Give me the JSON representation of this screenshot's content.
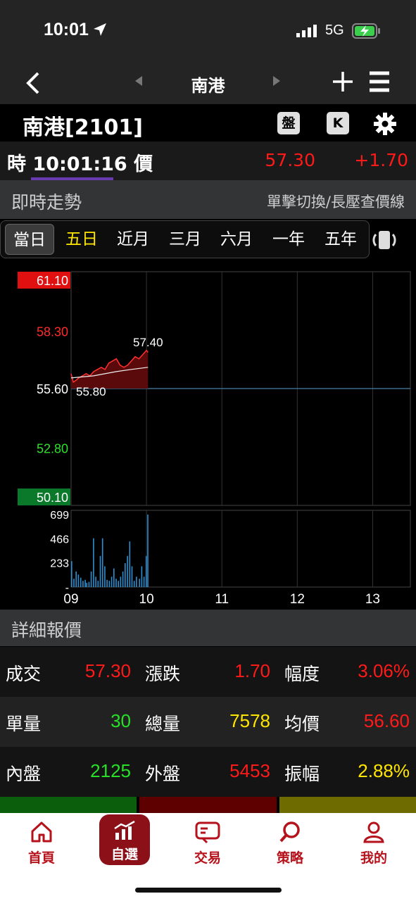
{
  "status_bar": {
    "time": "10:01",
    "network": "5G"
  },
  "nav": {
    "title": "南港"
  },
  "stock": {
    "name": "南港[2101]",
    "btn_pan": "盤",
    "btn_k": "K"
  },
  "quote": {
    "label_time": "時",
    "time": "10:01:16",
    "label_price": "價",
    "price": "57.30",
    "change": "+1.70"
  },
  "section": {
    "title": "即時走勢",
    "hint": "單擊切換/長壓查價線"
  },
  "tabs": [
    {
      "label": "當日",
      "selected": true
    },
    {
      "label": "五日",
      "highlight": true
    },
    {
      "label": "近月"
    },
    {
      "label": "三月"
    },
    {
      "label": "六月"
    },
    {
      "label": "一年"
    },
    {
      "label": "五年"
    }
  ],
  "chart_data": {
    "type": "line",
    "price_axis": {
      "ticks": [
        "61.10",
        "58.30",
        "55.60",
        "52.80",
        "50.10"
      ],
      "min": 50.1,
      "max": 61.1,
      "reference": 55.6
    },
    "annotations": {
      "high": "57.40",
      "low": "55.80"
    },
    "x_ticks": [
      "09",
      "10",
      "11",
      "12",
      "13"
    ],
    "volume_axis": {
      "ticks": [
        "699",
        "466",
        "233",
        "-"
      ],
      "max": 699
    },
    "price_series": [
      [
        9.0,
        56.3
      ],
      [
        9.03,
        55.9
      ],
      [
        9.07,
        56.0
      ],
      [
        9.1,
        56.1
      ],
      [
        9.15,
        56.2
      ],
      [
        9.2,
        56.3
      ],
      [
        9.25,
        56.2
      ],
      [
        9.3,
        56.4
      ],
      [
        9.35,
        56.5
      ],
      [
        9.4,
        56.6
      ],
      [
        9.45,
        56.5
      ],
      [
        9.5,
        56.8
      ],
      [
        9.55,
        56.9
      ],
      [
        9.6,
        57.0
      ],
      [
        9.65,
        56.7
      ],
      [
        9.7,
        56.6
      ],
      [
        9.75,
        56.7
      ],
      [
        9.8,
        56.9
      ],
      [
        9.85,
        57.1
      ],
      [
        9.9,
        57.0
      ],
      [
        9.95,
        57.2
      ],
      [
        10.0,
        57.4
      ],
      [
        10.02,
        57.3
      ]
    ],
    "avg_series": [
      [
        9.0,
        56.1
      ],
      [
        9.3,
        56.2
      ],
      [
        9.6,
        56.4
      ],
      [
        9.8,
        56.5
      ],
      [
        10.02,
        56.6
      ]
    ],
    "volume_series": [
      [
        9.0,
        250
      ],
      [
        9.03,
        80
      ],
      [
        9.06,
        150
      ],
      [
        9.09,
        120
      ],
      [
        9.12,
        90
      ],
      [
        9.15,
        60
      ],
      [
        9.18,
        70
      ],
      [
        9.2,
        40
      ],
      [
        9.23,
        50
      ],
      [
        9.26,
        150
      ],
      [
        9.29,
        470
      ],
      [
        9.32,
        100
      ],
      [
        9.35,
        60
      ],
      [
        9.38,
        300
      ],
      [
        9.41,
        470
      ],
      [
        9.44,
        200
      ],
      [
        9.47,
        70
      ],
      [
        9.5,
        60
      ],
      [
        9.53,
        100
      ],
      [
        9.56,
        180
      ],
      [
        9.59,
        80
      ],
      [
        9.62,
        60
      ],
      [
        9.65,
        100
      ],
      [
        9.68,
        150
      ],
      [
        9.71,
        230
      ],
      [
        9.74,
        300
      ],
      [
        9.77,
        440
      ],
      [
        9.8,
        200
      ],
      [
        9.83,
        60
      ],
      [
        9.86,
        100
      ],
      [
        9.9,
        80
      ],
      [
        9.93,
        200
      ],
      [
        9.96,
        100
      ],
      [
        9.99,
        300
      ],
      [
        10.01,
        699
      ]
    ]
  },
  "detail": {
    "title": "詳細報價",
    "rows": [
      [
        {
          "k": "成交",
          "v": "57.30",
          "c": "red"
        },
        {
          "k": "漲跌",
          "v": "1.70",
          "c": "red"
        },
        {
          "k": "幅度",
          "v": "3.06%",
          "c": "red"
        }
      ],
      [
        {
          "k": "單量",
          "v": "30",
          "c": "green"
        },
        {
          "k": "總量",
          "v": "7578",
          "c": "yellow"
        },
        {
          "k": "均價",
          "v": "56.60",
          "c": "red"
        }
      ],
      [
        {
          "k": "內盤",
          "v": "2125",
          "c": "green"
        },
        {
          "k": "外盤",
          "v": "5453",
          "c": "red"
        },
        {
          "k": "振幅",
          "v": "2.88%",
          "c": "yellow"
        }
      ]
    ]
  },
  "bottom_nav": [
    {
      "label": "首頁",
      "icon": "home-icon"
    },
    {
      "label": "自選",
      "icon": "chart-bars-icon",
      "active": true
    },
    {
      "label": "交易",
      "icon": "trade-card-icon"
    },
    {
      "label": "策略",
      "icon": "search-icon"
    },
    {
      "label": "我的",
      "icon": "user-icon"
    }
  ]
}
